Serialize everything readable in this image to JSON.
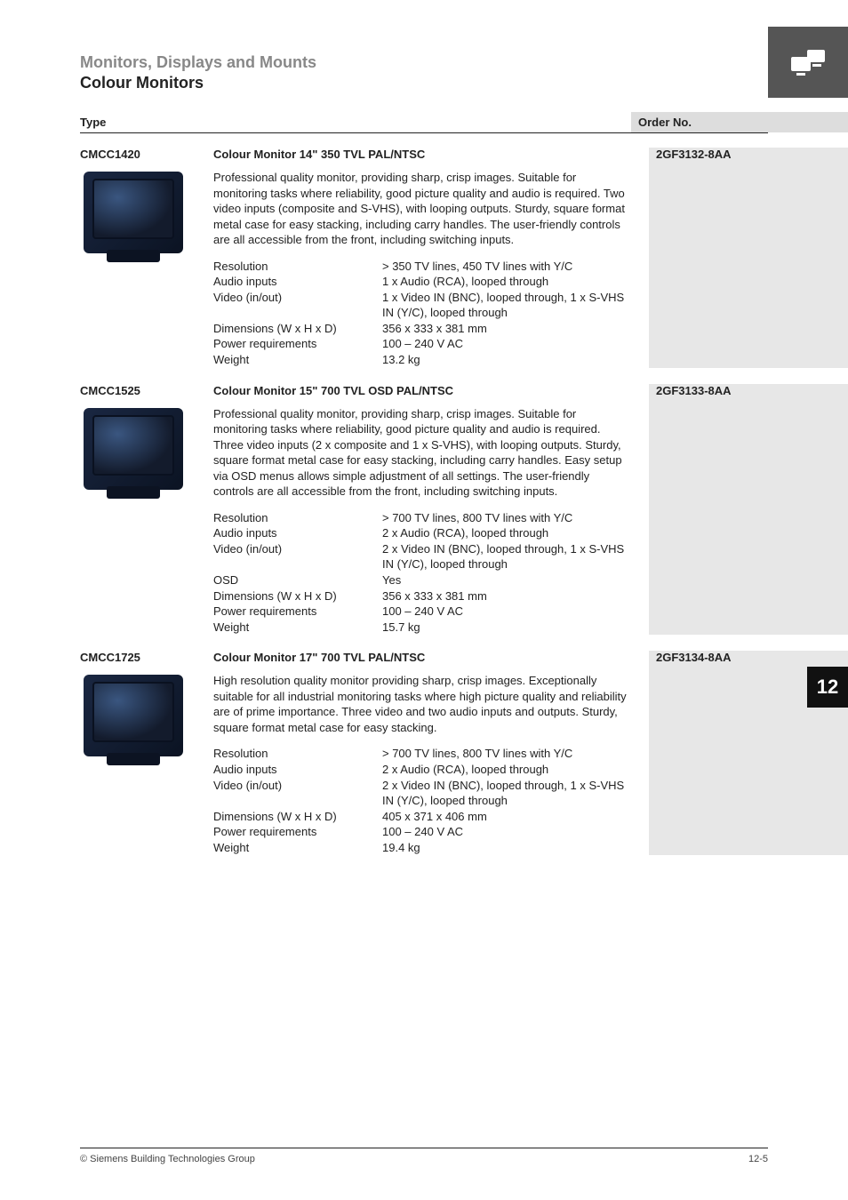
{
  "breadcrumb": "Monitors, Displays and Mounts",
  "section_title": "Colour Monitors",
  "table_header": {
    "type": "Type",
    "order": "Order No."
  },
  "side_tab": "12",
  "footer": {
    "left": "© Siemens Building Technologies Group",
    "right": "12-5"
  },
  "products": [
    {
      "type": "CMCC1420",
      "title": "Colour Monitor 14\" 350 TVL PAL/NTSC",
      "order": "2GF3132-8AA",
      "desc": "Professional quality monitor, providing sharp, crisp images. Suitable for monitoring tasks where reliability, good picture quality and audio is required. Two video inputs (composite and S-VHS), with looping outputs. Sturdy, square format metal case for easy stacking, including carry handles. The user-friendly controls are all accessible from the front, including switching inputs.",
      "specs": [
        {
          "label": "Resolution",
          "value": "> 350 TV lines, 450 TV lines with Y/C"
        },
        {
          "label": "Audio inputs",
          "value": "1 x Audio (RCA), looped through"
        },
        {
          "label": "Video (in/out)",
          "value": "1 x Video IN (BNC), looped through, 1 x S-VHS IN (Y/C), looped through"
        },
        {
          "label": "Dimensions (W x H x D)",
          "value": "356 x 333 x 381 mm"
        },
        {
          "label": "Power requirements",
          "value": "100 – 240 V AC"
        },
        {
          "label": "Weight",
          "value": "13.2 kg"
        }
      ]
    },
    {
      "type": "CMCC1525",
      "title": "Colour Monitor 15\" 700 TVL OSD PAL/NTSC",
      "order": "2GF3133-8AA",
      "desc": "Professional quality monitor, providing sharp, crisp images. Suitable for monitoring tasks where reliability, good picture quality and audio is required. Three video inputs (2 x composite and 1 x S-VHS), with looping outputs. Sturdy, square format metal case for easy stacking, including carry handles. Easy setup via OSD menus allows simple adjustment of all settings. The user-friendly controls are all accessible from the front, including switching inputs.",
      "specs": [
        {
          "label": "Resolution",
          "value": "> 700 TV lines, 800 TV lines with Y/C"
        },
        {
          "label": "Audio inputs",
          "value": "2 x Audio (RCA), looped through"
        },
        {
          "label": "Video (in/out)",
          "value": "2 x Video IN (BNC), looped through, 1 x S-VHS IN (Y/C), looped through"
        },
        {
          "label": "OSD",
          "value": "Yes"
        },
        {
          "label": "Dimensions (W x H x D)",
          "value": "356 x 333 x 381 mm"
        },
        {
          "label": "Power requirements",
          "value": "100 – 240 V AC"
        },
        {
          "label": "Weight",
          "value": "15.7 kg"
        }
      ]
    },
    {
      "type": "CMCC1725",
      "title": "Colour Monitor 17\" 700 TVL PAL/NTSC",
      "order": "2GF3134-8AA",
      "desc": "High resolution quality monitor providing sharp, crisp images. Exceptionally suitable for all industrial monitoring tasks where high picture quality and reliability are of prime importance. Three video and two audio inputs and outputs. Sturdy, square format metal case for easy stacking.",
      "specs": [
        {
          "label": "Resolution",
          "value": "> 700 TV lines, 800 TV lines with Y/C"
        },
        {
          "label": "Audio inputs",
          "value": "2 x Audio (RCA), looped through"
        },
        {
          "label": "Video (in/out)",
          "value": "2 x Video IN (BNC), looped through, 1 x S-VHS IN (Y/C), looped through"
        },
        {
          "label": "Dimensions (W x H x D)",
          "value": "405 x 371 x 406 mm"
        },
        {
          "label": "Power requirements",
          "value": "100 – 240 V AC"
        },
        {
          "label": "Weight",
          "value": "19.4 kg"
        }
      ]
    }
  ]
}
